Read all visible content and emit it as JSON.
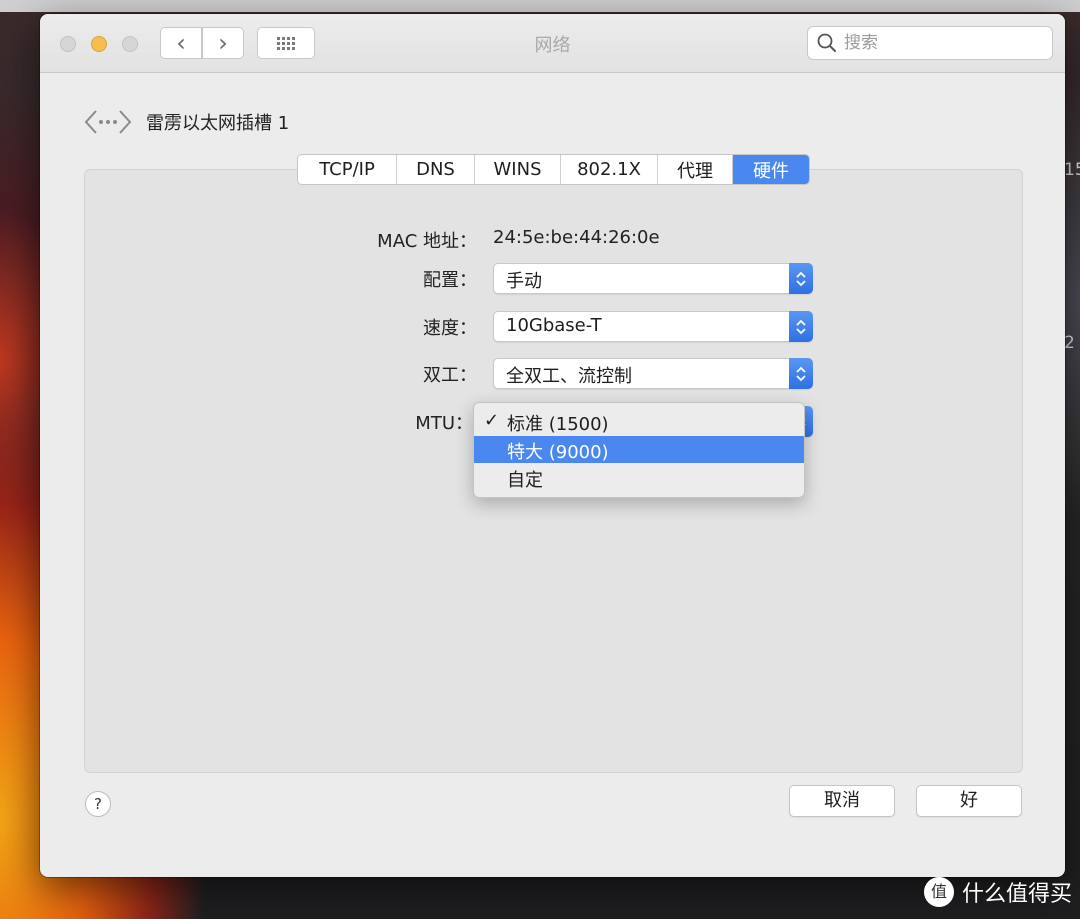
{
  "window": {
    "title": "网络",
    "search_placeholder": "搜索"
  },
  "interface": {
    "name": "雷雳以太网插槽 1"
  },
  "tabs": [
    {
      "label": "TCP/IP"
    },
    {
      "label": "DNS"
    },
    {
      "label": "WINS"
    },
    {
      "label": "802.1X"
    },
    {
      "label": "代理"
    },
    {
      "label": "硬件",
      "active": true
    }
  ],
  "hardware": {
    "mac_label": "MAC 地址：",
    "mac_value": "24:5e:be:44:26:0e",
    "config_label": "配置：",
    "config_value": "手动",
    "speed_label": "速度：",
    "speed_value": "10Gbase-T",
    "duplex_label": "双工：",
    "duplex_value": "全双工、流控制",
    "mtu_label": "MTU："
  },
  "mtu_menu": {
    "items": [
      {
        "label": "标准 (1500)",
        "checked": true,
        "check": "✓"
      },
      {
        "label": "特大 (9000)",
        "highlighted": true
      },
      {
        "label": "自定"
      }
    ]
  },
  "footer": {
    "help": "?",
    "cancel": "取消",
    "ok": "好"
  },
  "desktop": {
    "edge_label_1": "15",
    "edge_label_2": "2",
    "watermark": "什么值得买",
    "watermark_logo": "值"
  },
  "colors": {
    "accent": "#4a87ef",
    "window_bg": "#ececec",
    "panel_bg": "#e3e3e3"
  },
  "icons": [
    "back-chevron-icon",
    "forward-chevron-icon",
    "grid-icon",
    "search-icon",
    "ethernet-icon",
    "stepper-icon",
    "checkmark-icon",
    "help-icon"
  ]
}
